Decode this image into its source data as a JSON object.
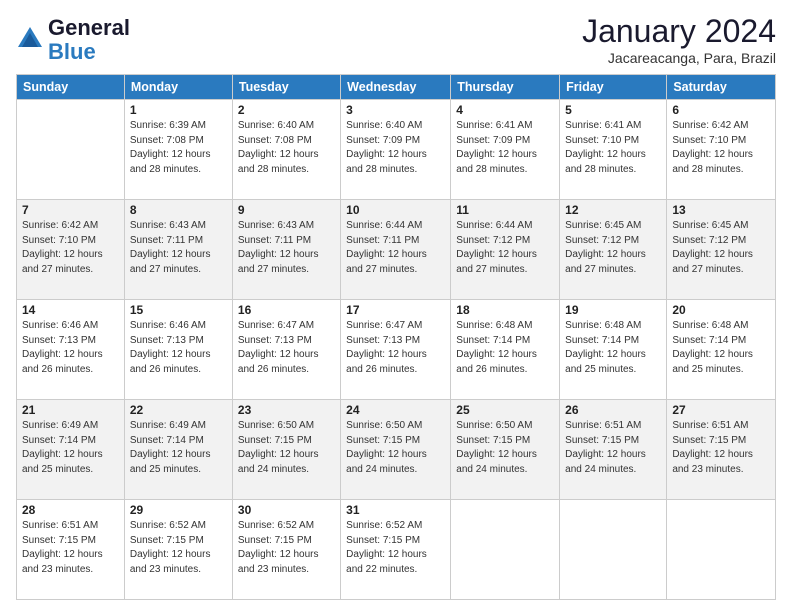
{
  "logo": {
    "line1": "General",
    "line2": "Blue"
  },
  "title": "January 2024",
  "subtitle": "Jacareacanga, Para, Brazil",
  "days_of_week": [
    "Sunday",
    "Monday",
    "Tuesday",
    "Wednesday",
    "Thursday",
    "Friday",
    "Saturday"
  ],
  "weeks": [
    [
      {
        "day": "",
        "sunrise": "",
        "sunset": "",
        "daylight": ""
      },
      {
        "day": "1",
        "sunrise": "Sunrise: 6:39 AM",
        "sunset": "Sunset: 7:08 PM",
        "daylight": "Daylight: 12 hours and 28 minutes."
      },
      {
        "day": "2",
        "sunrise": "Sunrise: 6:40 AM",
        "sunset": "Sunset: 7:08 PM",
        "daylight": "Daylight: 12 hours and 28 minutes."
      },
      {
        "day": "3",
        "sunrise": "Sunrise: 6:40 AM",
        "sunset": "Sunset: 7:09 PM",
        "daylight": "Daylight: 12 hours and 28 minutes."
      },
      {
        "day": "4",
        "sunrise": "Sunrise: 6:41 AM",
        "sunset": "Sunset: 7:09 PM",
        "daylight": "Daylight: 12 hours and 28 minutes."
      },
      {
        "day": "5",
        "sunrise": "Sunrise: 6:41 AM",
        "sunset": "Sunset: 7:10 PM",
        "daylight": "Daylight: 12 hours and 28 minutes."
      },
      {
        "day": "6",
        "sunrise": "Sunrise: 6:42 AM",
        "sunset": "Sunset: 7:10 PM",
        "daylight": "Daylight: 12 hours and 28 minutes."
      }
    ],
    [
      {
        "day": "7",
        "sunrise": "Sunrise: 6:42 AM",
        "sunset": "Sunset: 7:10 PM",
        "daylight": "Daylight: 12 hours and 27 minutes."
      },
      {
        "day": "8",
        "sunrise": "Sunrise: 6:43 AM",
        "sunset": "Sunset: 7:11 PM",
        "daylight": "Daylight: 12 hours and 27 minutes."
      },
      {
        "day": "9",
        "sunrise": "Sunrise: 6:43 AM",
        "sunset": "Sunset: 7:11 PM",
        "daylight": "Daylight: 12 hours and 27 minutes."
      },
      {
        "day": "10",
        "sunrise": "Sunrise: 6:44 AM",
        "sunset": "Sunset: 7:11 PM",
        "daylight": "Daylight: 12 hours and 27 minutes."
      },
      {
        "day": "11",
        "sunrise": "Sunrise: 6:44 AM",
        "sunset": "Sunset: 7:12 PM",
        "daylight": "Daylight: 12 hours and 27 minutes."
      },
      {
        "day": "12",
        "sunrise": "Sunrise: 6:45 AM",
        "sunset": "Sunset: 7:12 PM",
        "daylight": "Daylight: 12 hours and 27 minutes."
      },
      {
        "day": "13",
        "sunrise": "Sunrise: 6:45 AM",
        "sunset": "Sunset: 7:12 PM",
        "daylight": "Daylight: 12 hours and 27 minutes."
      }
    ],
    [
      {
        "day": "14",
        "sunrise": "Sunrise: 6:46 AM",
        "sunset": "Sunset: 7:13 PM",
        "daylight": "Daylight: 12 hours and 26 minutes."
      },
      {
        "day": "15",
        "sunrise": "Sunrise: 6:46 AM",
        "sunset": "Sunset: 7:13 PM",
        "daylight": "Daylight: 12 hours and 26 minutes."
      },
      {
        "day": "16",
        "sunrise": "Sunrise: 6:47 AM",
        "sunset": "Sunset: 7:13 PM",
        "daylight": "Daylight: 12 hours and 26 minutes."
      },
      {
        "day": "17",
        "sunrise": "Sunrise: 6:47 AM",
        "sunset": "Sunset: 7:13 PM",
        "daylight": "Daylight: 12 hours and 26 minutes."
      },
      {
        "day": "18",
        "sunrise": "Sunrise: 6:48 AM",
        "sunset": "Sunset: 7:14 PM",
        "daylight": "Daylight: 12 hours and 26 minutes."
      },
      {
        "day": "19",
        "sunrise": "Sunrise: 6:48 AM",
        "sunset": "Sunset: 7:14 PM",
        "daylight": "Daylight: 12 hours and 25 minutes."
      },
      {
        "day": "20",
        "sunrise": "Sunrise: 6:48 AM",
        "sunset": "Sunset: 7:14 PM",
        "daylight": "Daylight: 12 hours and 25 minutes."
      }
    ],
    [
      {
        "day": "21",
        "sunrise": "Sunrise: 6:49 AM",
        "sunset": "Sunset: 7:14 PM",
        "daylight": "Daylight: 12 hours and 25 minutes."
      },
      {
        "day": "22",
        "sunrise": "Sunrise: 6:49 AM",
        "sunset": "Sunset: 7:14 PM",
        "daylight": "Daylight: 12 hours and 25 minutes."
      },
      {
        "day": "23",
        "sunrise": "Sunrise: 6:50 AM",
        "sunset": "Sunset: 7:15 PM",
        "daylight": "Daylight: 12 hours and 24 minutes."
      },
      {
        "day": "24",
        "sunrise": "Sunrise: 6:50 AM",
        "sunset": "Sunset: 7:15 PM",
        "daylight": "Daylight: 12 hours and 24 minutes."
      },
      {
        "day": "25",
        "sunrise": "Sunrise: 6:50 AM",
        "sunset": "Sunset: 7:15 PM",
        "daylight": "Daylight: 12 hours and 24 minutes."
      },
      {
        "day": "26",
        "sunrise": "Sunrise: 6:51 AM",
        "sunset": "Sunset: 7:15 PM",
        "daylight": "Daylight: 12 hours and 24 minutes."
      },
      {
        "day": "27",
        "sunrise": "Sunrise: 6:51 AM",
        "sunset": "Sunset: 7:15 PM",
        "daylight": "Daylight: 12 hours and 23 minutes."
      }
    ],
    [
      {
        "day": "28",
        "sunrise": "Sunrise: 6:51 AM",
        "sunset": "Sunset: 7:15 PM",
        "daylight": "Daylight: 12 hours and 23 minutes."
      },
      {
        "day": "29",
        "sunrise": "Sunrise: 6:52 AM",
        "sunset": "Sunset: 7:15 PM",
        "daylight": "Daylight: 12 hours and 23 minutes."
      },
      {
        "day": "30",
        "sunrise": "Sunrise: 6:52 AM",
        "sunset": "Sunset: 7:15 PM",
        "daylight": "Daylight: 12 hours and 23 minutes."
      },
      {
        "day": "31",
        "sunrise": "Sunrise: 6:52 AM",
        "sunset": "Sunset: 7:15 PM",
        "daylight": "Daylight: 12 hours and 22 minutes."
      },
      {
        "day": "",
        "sunrise": "",
        "sunset": "",
        "daylight": ""
      },
      {
        "day": "",
        "sunrise": "",
        "sunset": "",
        "daylight": ""
      },
      {
        "day": "",
        "sunrise": "",
        "sunset": "",
        "daylight": ""
      }
    ]
  ]
}
